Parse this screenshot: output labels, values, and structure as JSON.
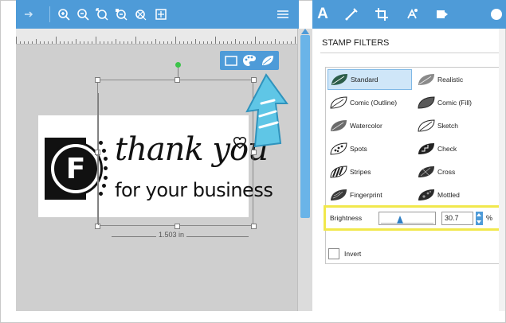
{
  "left_toolbar": {
    "icons": [
      "arrow-right-icon",
      "zoom-in-icon",
      "zoom-out-icon",
      "zoom-fit-icon",
      "zoom-selected-icon",
      "pan-icon",
      "page-fit-icon"
    ]
  },
  "right_toolbar": {
    "icons": [
      "menu-icon",
      "text-icon",
      "draw-icon",
      "crop-icon",
      "trace-icon",
      "send-icon",
      "stamp-icon"
    ],
    "text_label": "A"
  },
  "canvas": {
    "logo_letter": "F",
    "line1": "thank you",
    "line2": "for your business",
    "dimension": "1.503 in"
  },
  "panel": {
    "title": "STAMP FILTERS",
    "filters_left": [
      {
        "label": "Standard",
        "icon": "standard-leaf-icon",
        "selected": true
      },
      {
        "label": "Comic (Outline)",
        "icon": "comic-outline-leaf-icon",
        "selected": false
      },
      {
        "label": "Watercolor",
        "icon": "watercolor-leaf-icon",
        "selected": false
      },
      {
        "label": "Spots",
        "icon": "spots-leaf-icon",
        "selected": false
      },
      {
        "label": "Stripes",
        "icon": "stripes-leaf-icon",
        "selected": false
      },
      {
        "label": "Fingerprint",
        "icon": "fingerprint-leaf-icon",
        "selected": false
      }
    ],
    "filters_right": [
      {
        "label": "Realistic",
        "icon": "realistic-leaf-icon",
        "selected": false
      },
      {
        "label": "Comic (Fill)",
        "icon": "comic-fill-leaf-icon",
        "selected": false
      },
      {
        "label": "Sketch",
        "icon": "sketch-leaf-icon",
        "selected": false
      },
      {
        "label": "Check",
        "icon": "check-leaf-icon",
        "selected": false
      },
      {
        "label": "Cross",
        "icon": "cross-leaf-icon",
        "selected": false
      },
      {
        "label": "Mottled",
        "icon": "mottled-leaf-icon",
        "selected": false
      }
    ],
    "brightness": {
      "label": "Brightness",
      "value": "30.7",
      "unit": "%",
      "level": 0.307
    },
    "invert": {
      "label": "Invert",
      "checked": false
    }
  },
  "colors": {
    "toolbar": "#4e9bd8",
    "highlight": "#f1e84c",
    "selected_filter": "#cfe6f8",
    "slider_knob": "#2f7fc4"
  }
}
